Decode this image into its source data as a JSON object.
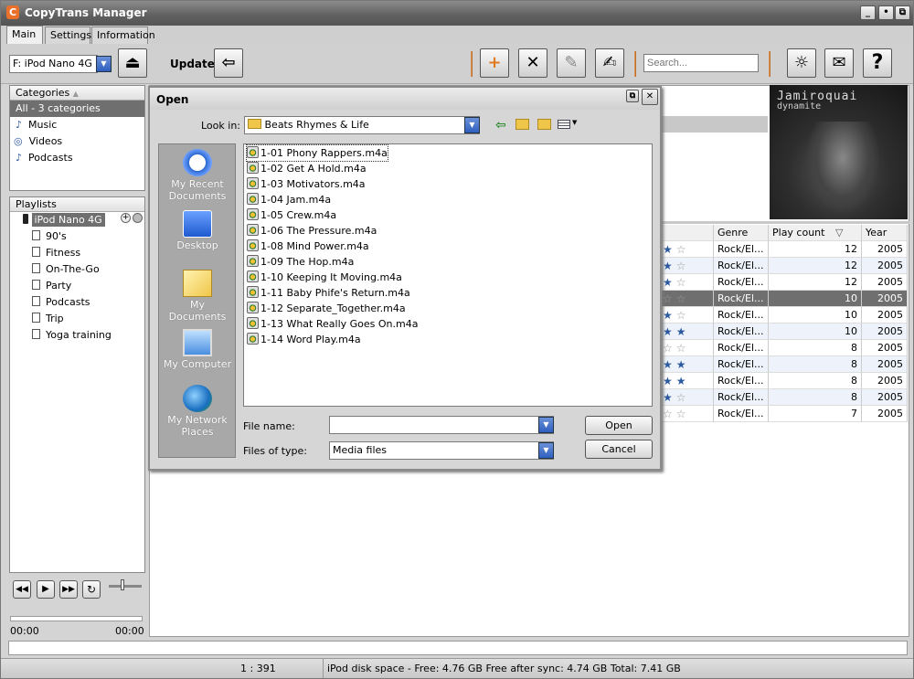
{
  "app": {
    "title": "CopyTrans Manager",
    "logo": "C",
    "window_buttons": [
      "_",
      "•",
      "⧉"
    ]
  },
  "tabs": [
    "Main",
    "Settings",
    "Information"
  ],
  "toolbar": {
    "device": "F: iPod Nano 4G",
    "update_label": "Update",
    "search_placeholder": "Search..."
  },
  "categories": {
    "header": "Categories",
    "items": [
      {
        "label": "All - 3 categories",
        "icon": "none"
      },
      {
        "label": "Music",
        "icon": "music-note-icon"
      },
      {
        "label": "Videos",
        "icon": "film-icon"
      },
      {
        "label": "Podcasts",
        "icon": "podcast-icon"
      }
    ]
  },
  "playlists": {
    "header": "Playlists",
    "device": "iPod Nano 4G",
    "items": [
      "90's",
      "Fitness",
      "On-The-Go",
      "Party",
      "Podcasts",
      "Trip",
      "Yoga training"
    ]
  },
  "player": {
    "time_start": "00:00",
    "time_end": "00:00"
  },
  "album_art": {
    "artist": "Jamiroquai",
    "album": "dynamite"
  },
  "grid": {
    "headers": [
      "Genre",
      "Play count",
      "Year"
    ],
    "sort_indicator": "▽",
    "rows": [
      {
        "stars": 1,
        "genre": "Rock/El...",
        "count": "12",
        "year": "2005"
      },
      {
        "stars": 1,
        "genre": "Rock/El...",
        "count": "12",
        "year": "2005"
      },
      {
        "stars": 1,
        "genre": "Rock/El...",
        "count": "12",
        "year": "2005"
      },
      {
        "stars": 0,
        "genre": "Rock/El...",
        "count": "10",
        "year": "2005"
      },
      {
        "stars": 1,
        "genre": "Rock/El...",
        "count": "10",
        "year": "2005"
      },
      {
        "stars": 2,
        "genre": "Rock/El...",
        "count": "10",
        "year": "2005"
      },
      {
        "stars": 0,
        "genre": "Rock/El...",
        "count": "8",
        "year": "2005"
      },
      {
        "stars": 2,
        "genre": "Rock/El...",
        "count": "8",
        "year": "2005"
      },
      {
        "stars": 2,
        "genre": "Rock/El...",
        "count": "8",
        "year": "2005"
      },
      {
        "stars": 1,
        "genre": "Rock/El...",
        "count": "8",
        "year": "2005"
      },
      {
        "stars": 0,
        "genre": "Rock/El...",
        "count": "7",
        "year": "2005"
      }
    ]
  },
  "dialog": {
    "title": "Open",
    "look_in_label": "Look in:",
    "look_in_value": "Beats Rhymes & Life",
    "places": [
      "My Recent Documents",
      "Desktop",
      "My Documents",
      "My Computer",
      "My Network Places"
    ],
    "files": [
      "1-01 Phony Rappers.m4a",
      "1-02 Get A Hold.m4a",
      "1-03 Motivators.m4a",
      "1-04 Jam.m4a",
      "1-05 Crew.m4a",
      "1-06 The Pressure.m4a",
      "1-08 Mind Power.m4a",
      "1-09 The Hop.m4a",
      "1-10 Keeping It Moving.m4a",
      "1-11 Baby Phife's Return.m4a",
      "1-12 Separate_Together.m4a",
      "1-13 What Really Goes On.m4a",
      "1-14 Word Play.m4a"
    ],
    "file_name_label": "File name:",
    "file_name_value": "",
    "files_of_type_label": "Files of type:",
    "files_of_type_value": "Media files",
    "open_label": "Open",
    "cancel_label": "Cancel"
  },
  "status": {
    "count": "1 : 391",
    "disk": "iPod disk space - Free: 4.76 GB Free after sync: 4.74 GB Total: 7.41 GB"
  }
}
